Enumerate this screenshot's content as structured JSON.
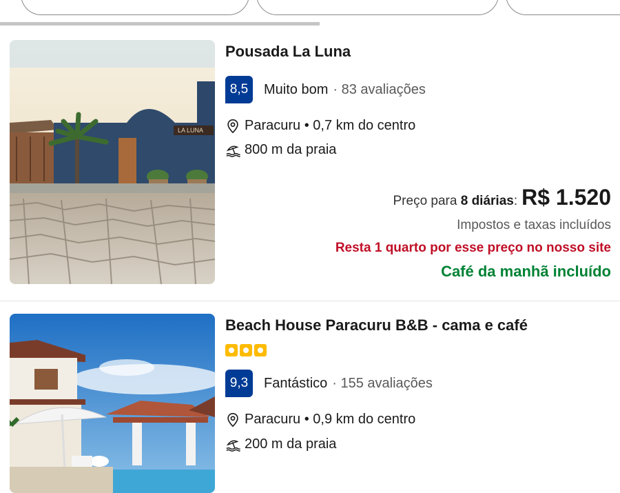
{
  "filter_chips": [
    "",
    "",
    ""
  ],
  "properties": [
    {
      "name": "Pousada La Luna",
      "score": "8,5",
      "rating_word": "Muito bom",
      "reviews": "· 83 avaliações",
      "location": "Paracuru • 0,7 km do centro",
      "beach": "800 m da praia",
      "price_prefix": "Preço para ",
      "price_nights": "8 diárias",
      "price_suffix": ":",
      "price": "R$ 1.520",
      "taxes": "Impostos e taxas incluídos",
      "scarcity": "Resta 1 quarto por esse preço no nosso site",
      "breakfast": "Café da manhã incluído",
      "sign_text": "LA LUNA"
    },
    {
      "name": "Beach House Paracuru B&B - cama e café",
      "stars": 3,
      "score": "9,3",
      "rating_word": "Fantástico",
      "reviews": "· 155 avaliações",
      "location": "Paracuru • 0,9 km do centro",
      "beach": "200 m da praia"
    }
  ],
  "colors": {
    "score_bg": "#003b95",
    "scarcity": "#c00f27",
    "breakfast": "#008234",
    "star": "#febb02"
  }
}
